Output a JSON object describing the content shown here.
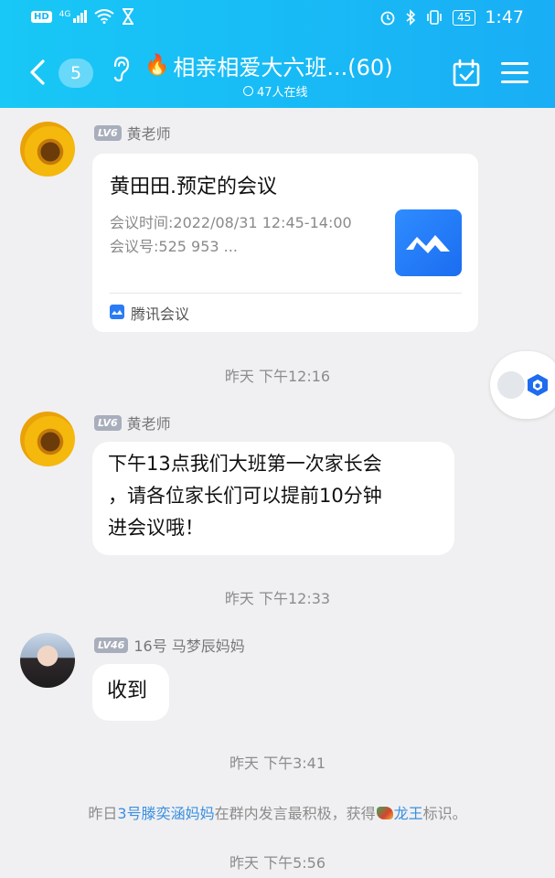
{
  "status_bar": {
    "net_badge": "HD",
    "signal_label": "4G",
    "battery": "45",
    "time": "1:47"
  },
  "header": {
    "unread_count": "5",
    "title": "相亲相爱大六班...(60)",
    "online": "47人在线"
  },
  "messages": [
    {
      "level": "LV6",
      "sender": "黄老师",
      "card": {
        "title": "黄田田.预定的会议",
        "time_line": "会议时间:2022/08/31 12:45-14:00",
        "id_line": "会议号:525 953 ...",
        "source": "腾讯会议"
      }
    },
    {
      "timestamp": "昨天 下午12:16"
    },
    {
      "level": "LV6",
      "sender": "黄老师",
      "lines": [
        "下午13点我们大班第一次家长会",
        "，请各位家长们可以提前10分钟",
        "进会议哦！"
      ]
    },
    {
      "timestamp": "昨天 下午12:33"
    },
    {
      "level": "LV46",
      "sender": "16号 马梦辰妈妈",
      "text": "收到"
    },
    {
      "timestamp": "昨天 下午3:41"
    },
    {
      "system": {
        "prefix": "昨日",
        "user": "3号滕奕涵妈妈",
        "middle": "在群内发言最积极，获得",
        "badge_icon": "dragon-badge-icon",
        "badge": "龙王",
        "suffix": "标识。"
      }
    },
    {
      "timestamp": "昨天 下午5:56"
    }
  ],
  "colors": {
    "header_start": "#18c8f6",
    "header_end": "#19aef5",
    "link": "#3a8fe0",
    "background": "#f0f0f2"
  }
}
